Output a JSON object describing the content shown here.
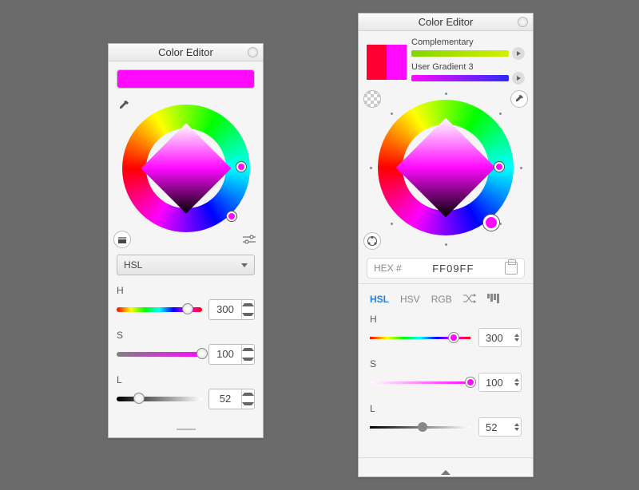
{
  "left": {
    "title": "Color Editor",
    "swatch_color": "#ff09ff",
    "model_select": "HSL",
    "sliders": {
      "h": {
        "label": "H",
        "value": "300",
        "pct": 83
      },
      "s": {
        "label": "S",
        "value": "100",
        "pct": 100
      },
      "l": {
        "label": "L",
        "value": "52",
        "pct": 26
      }
    }
  },
  "right": {
    "title": "Color Editor",
    "swatch_a": "#ff0033",
    "swatch_b": "#ff09ff",
    "gradients": [
      {
        "label": "Complementary",
        "from": "#84d400",
        "to": "#d4f000"
      },
      {
        "label": "User Gradient 3",
        "from": "#ff09ff",
        "to": "#2a2aff"
      }
    ],
    "hex_label": "HEX #",
    "hex_value": "FF09FF",
    "tabs": {
      "hsl": "HSL",
      "hsv": "HSV",
      "rgb": "RGB"
    },
    "active_tab": "HSL",
    "sliders": {
      "h": {
        "label": "H",
        "value": "300",
        "pct": 83
      },
      "s": {
        "label": "S",
        "value": "100",
        "pct": 100
      },
      "l": {
        "label": "L",
        "value": "52",
        "pct": 52
      }
    }
  }
}
